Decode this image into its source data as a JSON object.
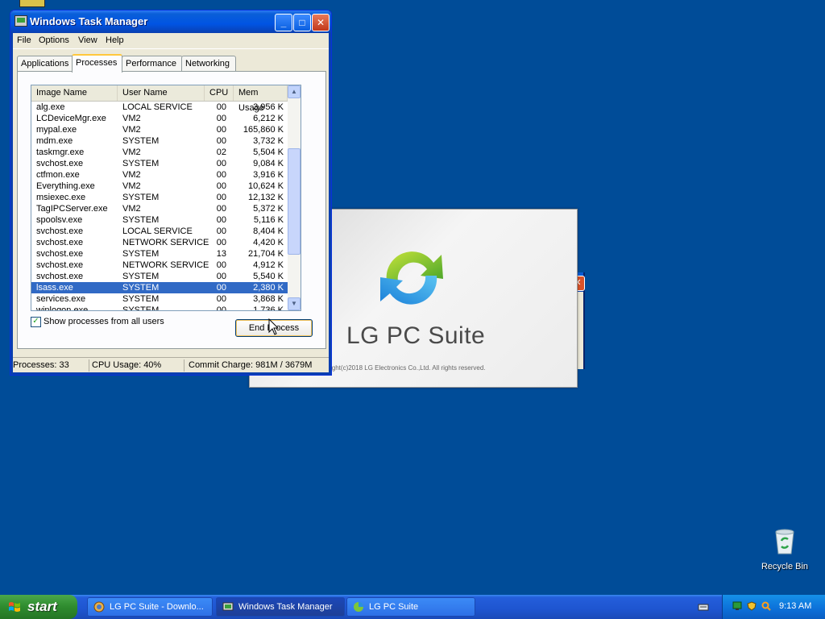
{
  "desktop": {
    "recycle_bin_label": "Recycle Bin"
  },
  "splash": {
    "title": "LG PC Suite",
    "copyright": "ight(c)2018 LG Electronics Co.,Ltd. All rights reserved."
  },
  "taskmanager": {
    "title": "Windows Task Manager",
    "menu": [
      "File",
      "Options",
      "View",
      "Help"
    ],
    "tabs": [
      "Applications",
      "Processes",
      "Performance",
      "Networking"
    ],
    "active_tab": "Processes",
    "columns": [
      "Image Name",
      "User Name",
      "CPU",
      "Mem Usage"
    ],
    "processes": [
      {
        "name": "alg.exe",
        "user": "LOCAL SERVICE",
        "cpu": "00",
        "mem": "3,956 K"
      },
      {
        "name": "LCDeviceMgr.exe",
        "user": "VM2",
        "cpu": "00",
        "mem": "6,212 K"
      },
      {
        "name": "mypal.exe",
        "user": "VM2",
        "cpu": "00",
        "mem": "165,860 K"
      },
      {
        "name": "mdm.exe",
        "user": "SYSTEM",
        "cpu": "00",
        "mem": "3,732 K"
      },
      {
        "name": "taskmgr.exe",
        "user": "VM2",
        "cpu": "02",
        "mem": "5,504 K"
      },
      {
        "name": "svchost.exe",
        "user": "SYSTEM",
        "cpu": "00",
        "mem": "9,084 K"
      },
      {
        "name": "ctfmon.exe",
        "user": "VM2",
        "cpu": "00",
        "mem": "3,916 K"
      },
      {
        "name": "Everything.exe",
        "user": "VM2",
        "cpu": "00",
        "mem": "10,624 K"
      },
      {
        "name": "msiexec.exe",
        "user": "SYSTEM",
        "cpu": "00",
        "mem": "12,132 K"
      },
      {
        "name": "TagIPCServer.exe",
        "user": "VM2",
        "cpu": "00",
        "mem": "5,372 K"
      },
      {
        "name": "spoolsv.exe",
        "user": "SYSTEM",
        "cpu": "00",
        "mem": "5,116 K"
      },
      {
        "name": "svchost.exe",
        "user": "LOCAL SERVICE",
        "cpu": "00",
        "mem": "8,404 K"
      },
      {
        "name": "svchost.exe",
        "user": "NETWORK SERVICE",
        "cpu": "00",
        "mem": "4,420 K"
      },
      {
        "name": "svchost.exe",
        "user": "SYSTEM",
        "cpu": "13",
        "mem": "21,704 K"
      },
      {
        "name": "svchost.exe",
        "user": "NETWORK SERVICE",
        "cpu": "00",
        "mem": "4,912 K"
      },
      {
        "name": "svchost.exe",
        "user": "SYSTEM",
        "cpu": "00",
        "mem": "5,540 K"
      },
      {
        "name": "lsass.exe",
        "user": "SYSTEM",
        "cpu": "00",
        "mem": "2,380 K",
        "selected": true
      },
      {
        "name": "services.exe",
        "user": "SYSTEM",
        "cpu": "00",
        "mem": "3,868 K"
      },
      {
        "name": "winlogon.exe",
        "user": "SYSTEM",
        "cpu": "00",
        "mem": "1,736 K"
      }
    ],
    "show_all_users_label": "Show processes from all users",
    "show_all_users_checked": true,
    "end_process_label": "End Process",
    "status": {
      "processes": "Processes: 33",
      "cpu": "CPU Usage: 40%",
      "commit": "Commit Charge: 981M / 3679M"
    }
  },
  "taskbar": {
    "start_label": "start",
    "tasks": [
      {
        "label": "LG PC Suite - Downlo...",
        "icon": "browser-icon"
      },
      {
        "label": "Windows Task Manager",
        "icon": "taskmanager-icon",
        "active": true
      },
      {
        "label": "LG PC Suite",
        "icon": "lg-suite-icon"
      }
    ],
    "clock": "9:13 AM"
  },
  "colors": {
    "desktop_bg": "#004c98",
    "titlebar": "#0054e3",
    "selection": "#316ac5",
    "start_green": "#2e8b2e"
  }
}
